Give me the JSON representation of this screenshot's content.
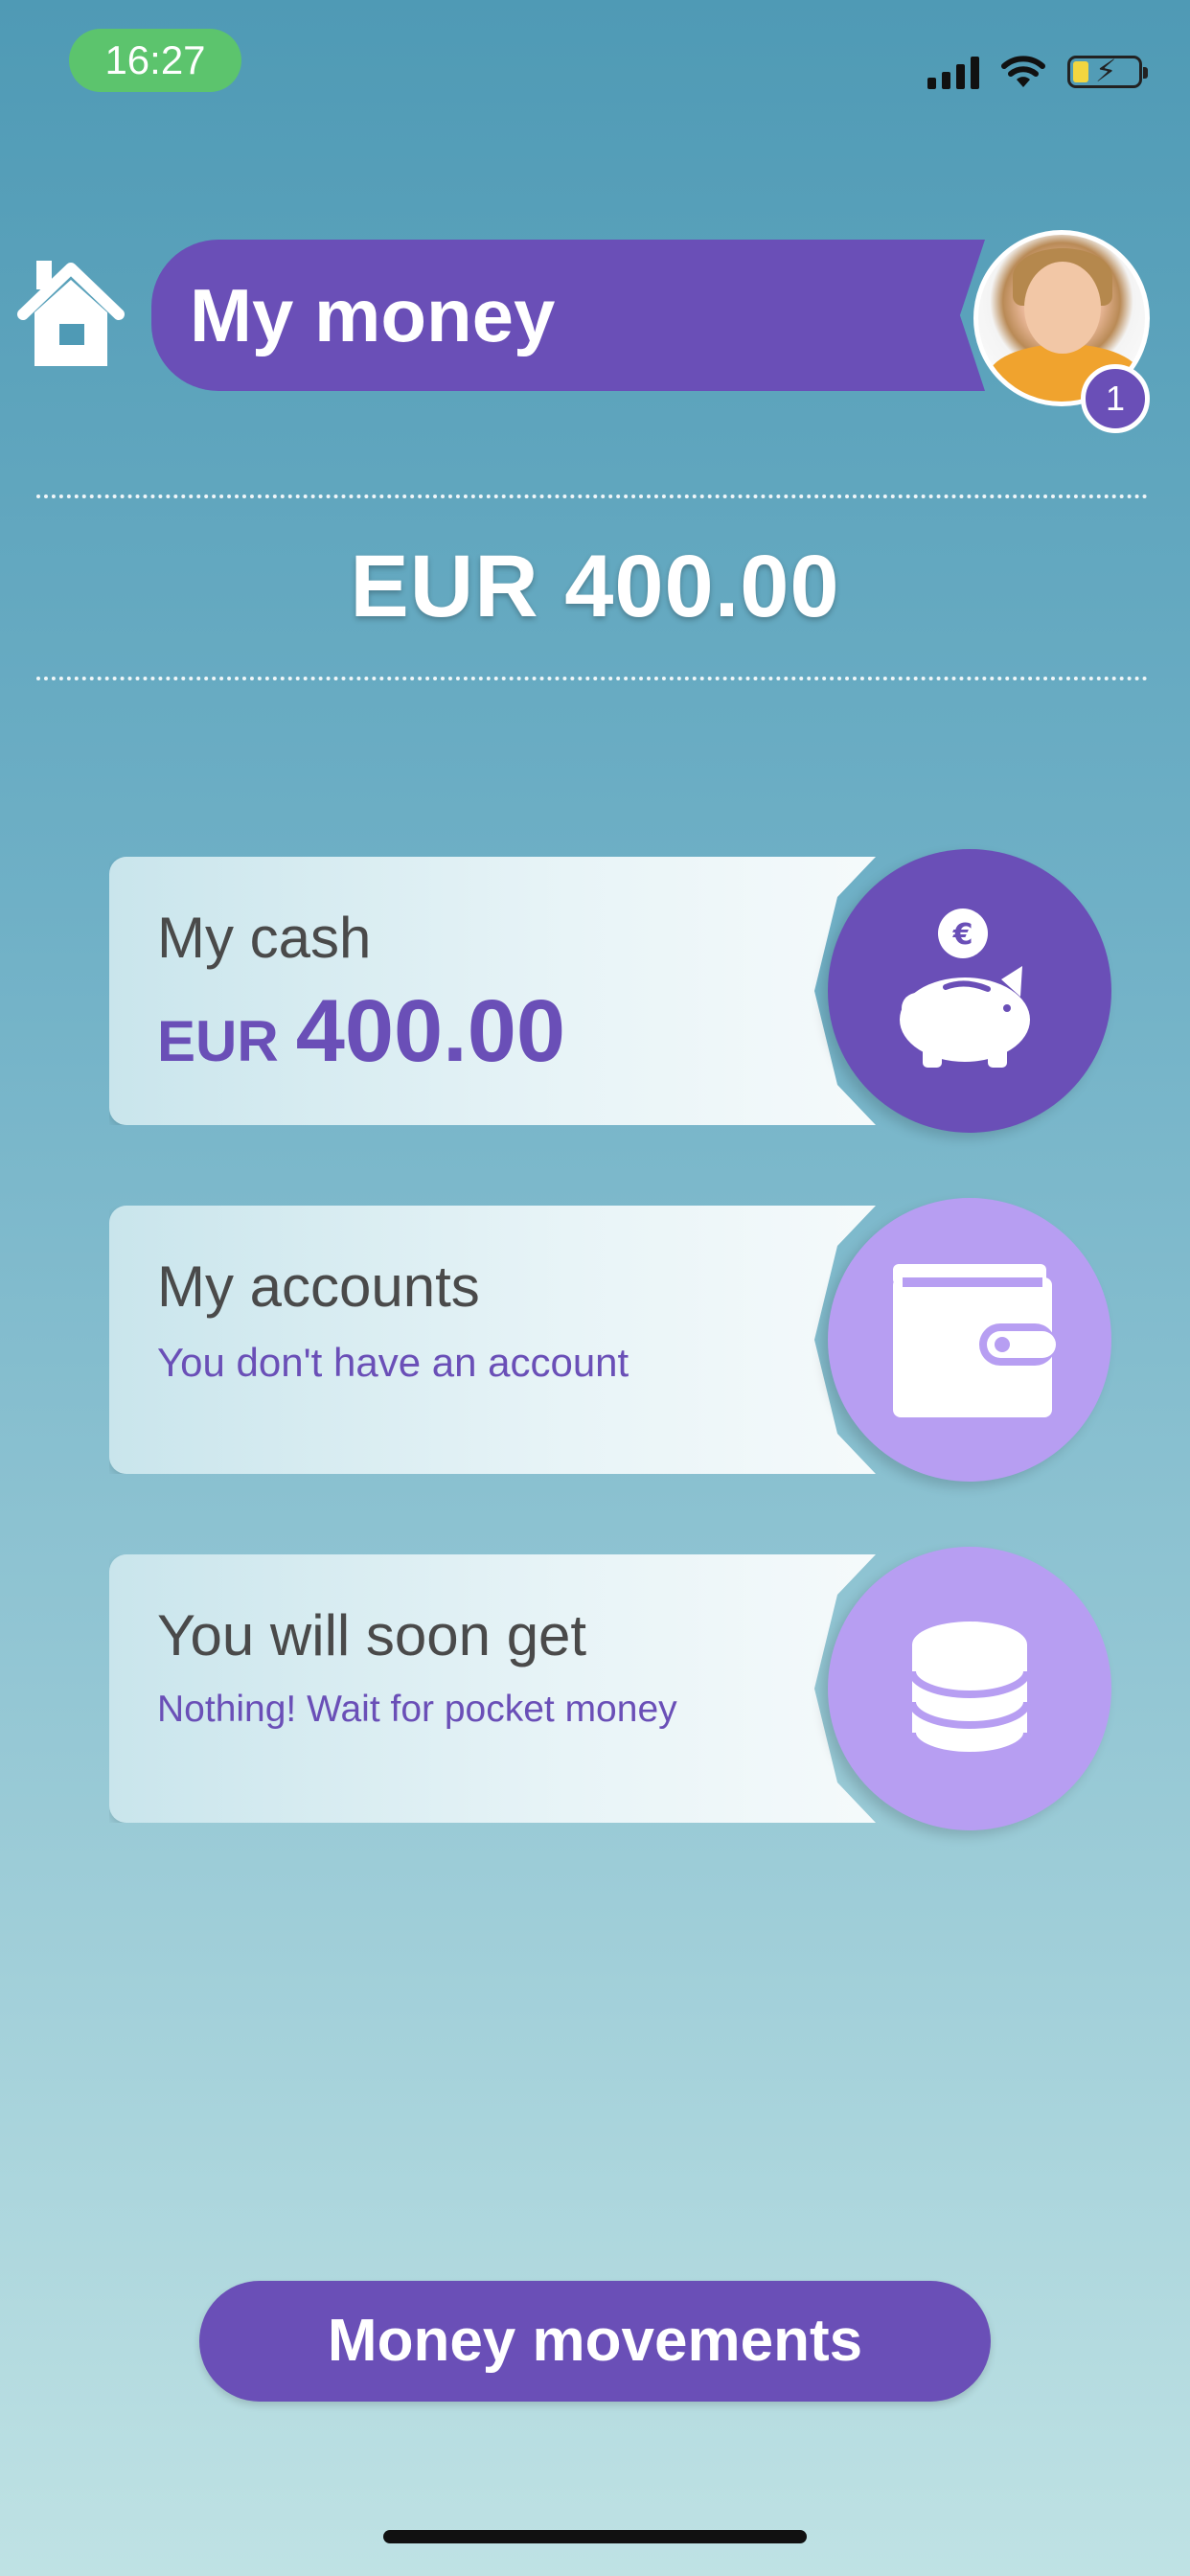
{
  "status_bar": {
    "time": "16:27"
  },
  "header": {
    "title": "My money",
    "notification_count": "1"
  },
  "balance": {
    "text": "EUR 400.00"
  },
  "cards": {
    "cash": {
      "title": "My cash",
      "currency": "EUR",
      "amount": "400.00",
      "icon": "piggy-bank-euro-icon"
    },
    "accounts": {
      "title": "My accounts",
      "subtitle": "You don't have an account",
      "icon": "wallet-icon"
    },
    "upcoming": {
      "title": "You will soon get",
      "subtitle": "Nothing! Wait for pocket money",
      "icon": "coin-stack-icon"
    }
  },
  "cta": {
    "label": "Money movements"
  },
  "colors": {
    "accent": "#6a4fb7",
    "accent_light": "#b79ef2",
    "status_green": "#5cc46d"
  }
}
